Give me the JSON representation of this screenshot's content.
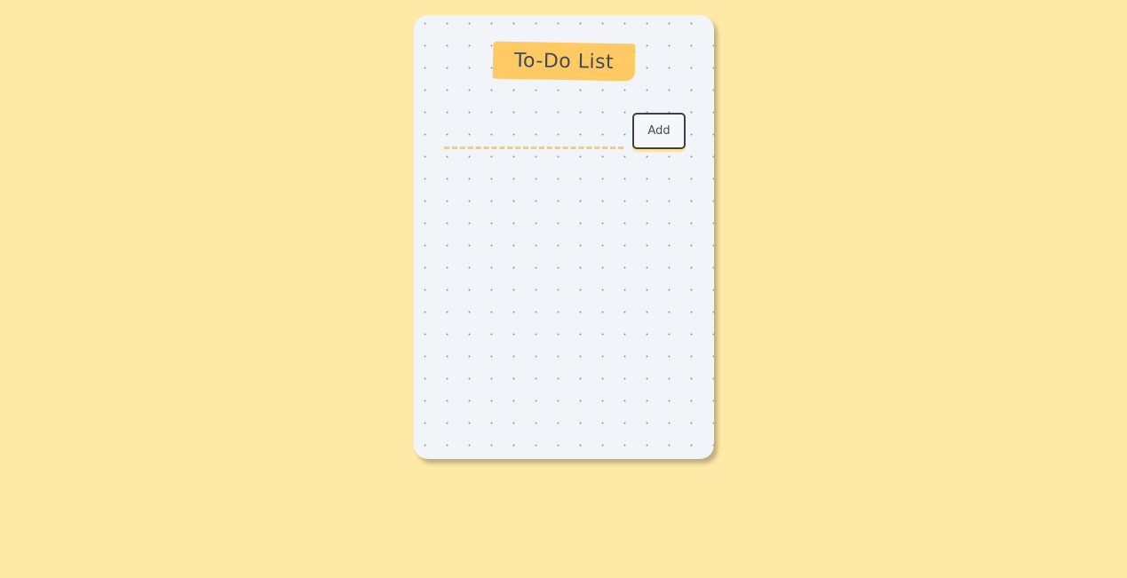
{
  "app": {
    "title": "To-Do List"
  },
  "form": {
    "input_value": "",
    "input_placeholder": "",
    "add_label": "Add"
  },
  "tasks": [],
  "colors": {
    "background": "#ffe9a6",
    "card": "#f1f4f8",
    "accent": "#ffc963",
    "text": "#444a55",
    "button_border": "#3c4048"
  }
}
